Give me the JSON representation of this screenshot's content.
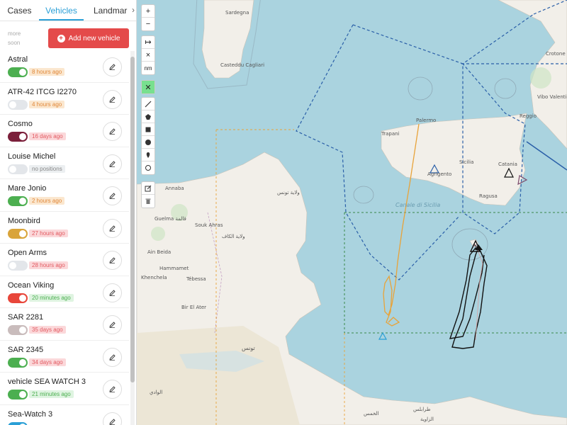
{
  "tabs": [
    "Cases",
    "Vehicles",
    "Landmarks"
  ],
  "tab_overflow": "›",
  "more_soon": "more soon",
  "add_button_label": "Add new vehicle",
  "vehicles": [
    {
      "name": "Astral",
      "status": "8 hours ago",
      "tone": "orange",
      "toggle_color": "#4caf50",
      "toggle_on": true
    },
    {
      "name": "ATR-42 ITCG I2270",
      "status": "4 hours ago",
      "tone": "orange",
      "toggle_color": "#e3e6ea",
      "toggle_on": false
    },
    {
      "name": "Cosmo",
      "status": "16 days ago",
      "tone": "red",
      "toggle_color": "#7b1f3a",
      "toggle_on": true
    },
    {
      "name": "Louise Michel",
      "status": "no positions",
      "tone": "grey",
      "toggle_color": "#e3e6ea",
      "toggle_on": false
    },
    {
      "name": "Mare Jonio",
      "status": "2 hours ago",
      "tone": "orange",
      "toggle_color": "#4caf50",
      "toggle_on": true
    },
    {
      "name": "Moonbird",
      "status": "27 hours ago",
      "tone": "red",
      "toggle_color": "#d9a43a",
      "toggle_on": true
    },
    {
      "name": "Open Arms",
      "status": "28 hours ago",
      "tone": "red",
      "toggle_color": "#e3e6ea",
      "toggle_on": false
    },
    {
      "name": "Ocean Viking",
      "status": "20 minutes ago",
      "tone": "green",
      "toggle_color": "#e8463a",
      "toggle_on": true
    },
    {
      "name": "SAR 2281",
      "status": "35 days ago",
      "tone": "red",
      "toggle_color": "#c9bcbc",
      "toggle_on": true
    },
    {
      "name": "SAR 2345",
      "status": "34 days ago",
      "tone": "red",
      "toggle_color": "#4caf50",
      "toggle_on": true
    },
    {
      "name": "vehicle SEA WATCH 3",
      "status": "21 minutes ago",
      "tone": "green",
      "toggle_color": "#4caf50",
      "toggle_on": true
    },
    {
      "name": "Sea-Watch 3",
      "status": "",
      "tone": "green",
      "toggle_color": "#2a9fd6",
      "toggle_on": true
    }
  ],
  "map_tools": {
    "zoom_in": "+",
    "zoom_out": "−",
    "measure": "↦",
    "clear": "×",
    "unit": "nm",
    "confirm": "✕"
  },
  "map_labels": {
    "sardegna": "Sardegna",
    "casteddu": "Casteddu Cagliari",
    "palermo": "Palermo",
    "trapani": "Trapani",
    "agrigento": "Agrigento",
    "sicilia": "Sicilia",
    "catania": "Catania",
    "ragusa": "Ragusa",
    "vibo": "Vibo Valentia",
    "reggio": "Reggio",
    "crotone": "Crotone",
    "annaba": "Annaba",
    "guelma": "Guelma قالمة",
    "souk_ahras": "Souk Ahras",
    "el_kef": "ولاية الكاف",
    "ain_beida": "Ain Beida",
    "hammamet": "Hammamet",
    "khenchela": "Khenchela",
    "tebessa": "Tébessa",
    "bir_el_ater": "Bir El Ater",
    "el_wadi": "الوادي",
    "tunis_ar": "ولاية تونس",
    "canale": "Canale di Sicilia",
    "tunisia_ar": "تونس",
    "zawiya": "الزاوية",
    "tarabulus": "طرابلس",
    "khums": "الخمس"
  },
  "colors": {
    "sea": "#aad3df",
    "land": "#f2efe9",
    "track_orange": "#e8a33a",
    "track_black": "#111111",
    "sar_blue": "#2a5fa8",
    "sar_green": "#3a8a4a"
  }
}
